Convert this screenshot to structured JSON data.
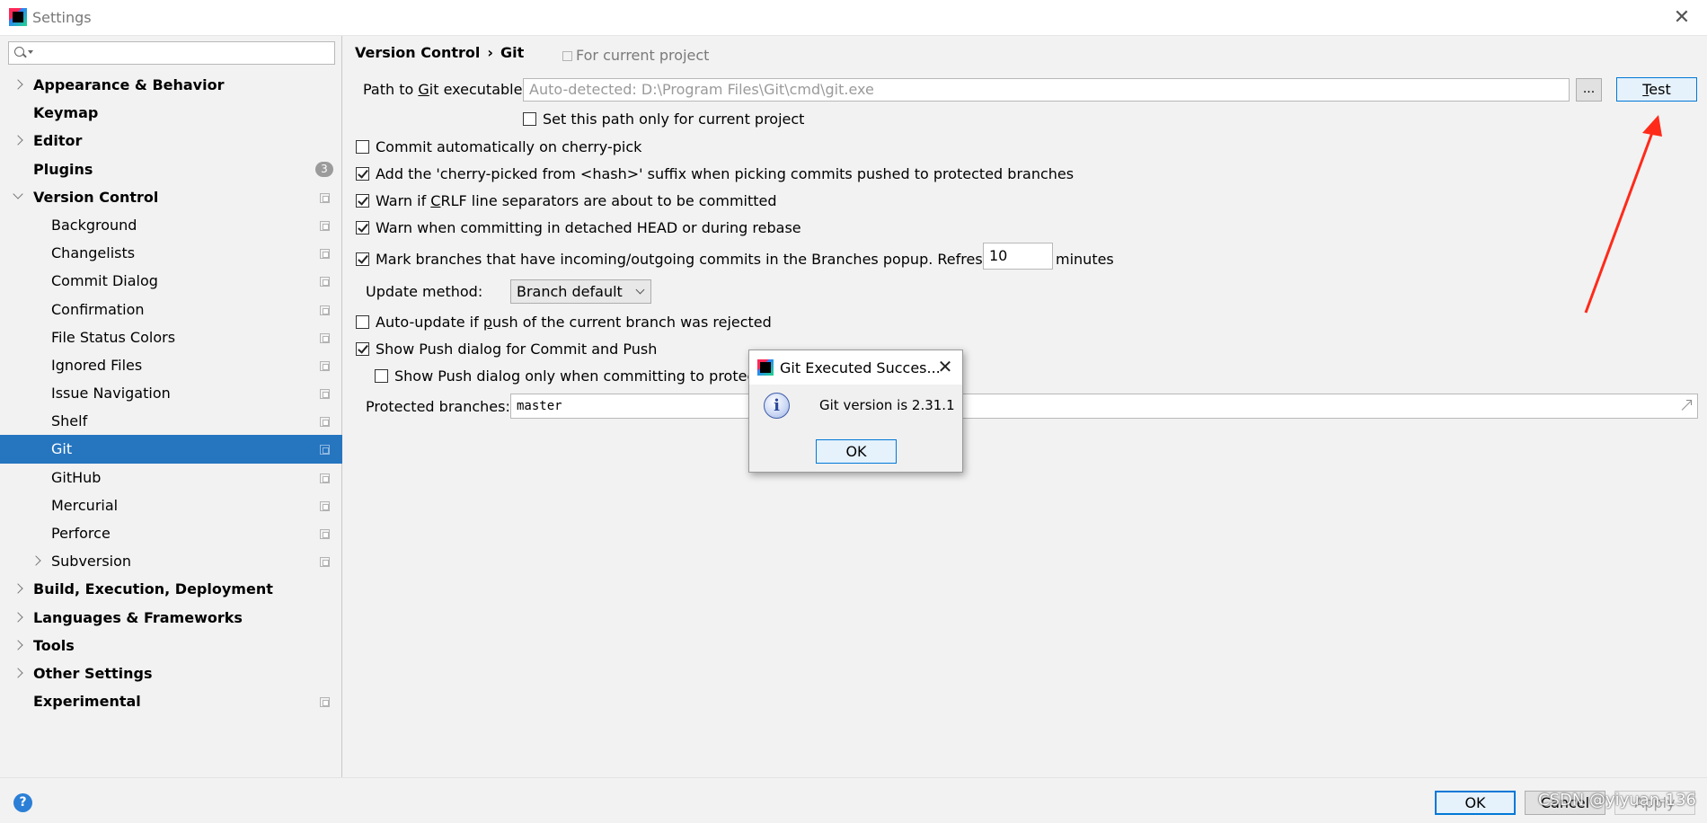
{
  "window": {
    "title": "Settings",
    "close_glyph": "✕"
  },
  "sidebar": {
    "search_placeholder": "",
    "items": [
      {
        "label": "Appearance & Behavior",
        "level": 0,
        "arrow": "right"
      },
      {
        "label": "Keymap",
        "level": 0
      },
      {
        "label": "Editor",
        "level": 0,
        "arrow": "right"
      },
      {
        "label": "Plugins",
        "level": 0,
        "badge": "3"
      },
      {
        "label": "Version Control",
        "level": 0,
        "arrow": "down"
      },
      {
        "label": "Background",
        "level": 1
      },
      {
        "label": "Changelists",
        "level": 1
      },
      {
        "label": "Commit Dialog",
        "level": 1
      },
      {
        "label": "Confirmation",
        "level": 1
      },
      {
        "label": "File Status Colors",
        "level": 1
      },
      {
        "label": "Ignored Files",
        "level": 1
      },
      {
        "label": "Issue Navigation",
        "level": 1
      },
      {
        "label": "Shelf",
        "level": 1
      },
      {
        "label": "Git",
        "level": 1,
        "selected": true
      },
      {
        "label": "GitHub",
        "level": 1
      },
      {
        "label": "Mercurial",
        "level": 1
      },
      {
        "label": "Perforce",
        "level": 1
      },
      {
        "label": "Subversion",
        "level": 1,
        "arrow": "right"
      },
      {
        "label": "Build, Execution, Deployment",
        "level": 0,
        "arrow": "right"
      },
      {
        "label": "Languages & Frameworks",
        "level": 0,
        "arrow": "right"
      },
      {
        "label": "Tools",
        "level": 0,
        "arrow": "right"
      },
      {
        "label": "Other Settings",
        "level": 0,
        "arrow": "right"
      },
      {
        "label": "Experimental",
        "level": 0
      }
    ]
  },
  "breadcrumb": {
    "parent": "Version Control",
    "separator": "›",
    "current": "Git",
    "scope_note": "For current project"
  },
  "git_path": {
    "label_pre": "Path to ",
    "label_underlined": "G",
    "label_post": "it executable:",
    "value": "Auto-detected: D:\\Program Files\\Git\\cmd\\git.exe",
    "browse_label": "...",
    "test_label_underlined": "T",
    "test_label_rest": "est",
    "current_project_only": {
      "label": "Set this path only for current project",
      "checked": false
    }
  },
  "options": {
    "commit_cherry_pick": {
      "label": "Commit automatically on cherry-pick",
      "checked": false
    },
    "cherry_picked_suffix": {
      "label": "Add the 'cherry-picked from <hash>' suffix when picking commits pushed to protected branches",
      "checked": true
    },
    "warn_crlf": {
      "label_pre": "Warn if ",
      "label_underlined": "C",
      "label_post": "RLF line separators are about to be committed",
      "checked": true
    },
    "warn_detached": {
      "label": "Warn when committing in detached HEAD or during rebase",
      "checked": true
    },
    "mark_branches": {
      "label": "Mark branches that have incoming/outgoing commits in the Branches popup.  Refresh every",
      "checked": true,
      "refresh_value": "10",
      "unit": "minutes"
    },
    "update_method": {
      "label": "Update method:",
      "value": "Branch default"
    },
    "auto_update": {
      "label_pre": "Auto-update if ",
      "label_underlined": "p",
      "label_post": "ush of the current branch was rejected",
      "checked": false
    },
    "show_push": {
      "label": "Show Push dialog for Commit and Push",
      "checked": true
    },
    "show_push_protected": {
      "label": "Show Push dialog only when committing to protected branches",
      "checked": false
    },
    "protected_branches": {
      "label": "Protected branches:",
      "value": "master"
    }
  },
  "popup": {
    "title": "Git Executed Succes...",
    "close_glyph": "✕",
    "message": "Git version is 2.31.1",
    "ok_label": "OK",
    "icon_glyph": "i"
  },
  "footer": {
    "help_glyph": "?",
    "ok_label": "OK",
    "cancel_label": "Cancel",
    "apply_label": "Apply",
    "watermark": "CSDN @yiyuan-136"
  },
  "colors": {
    "selection": "#2675bf",
    "focus_border": "#0078d7",
    "annotation_arrow": "#ff2a1a"
  }
}
